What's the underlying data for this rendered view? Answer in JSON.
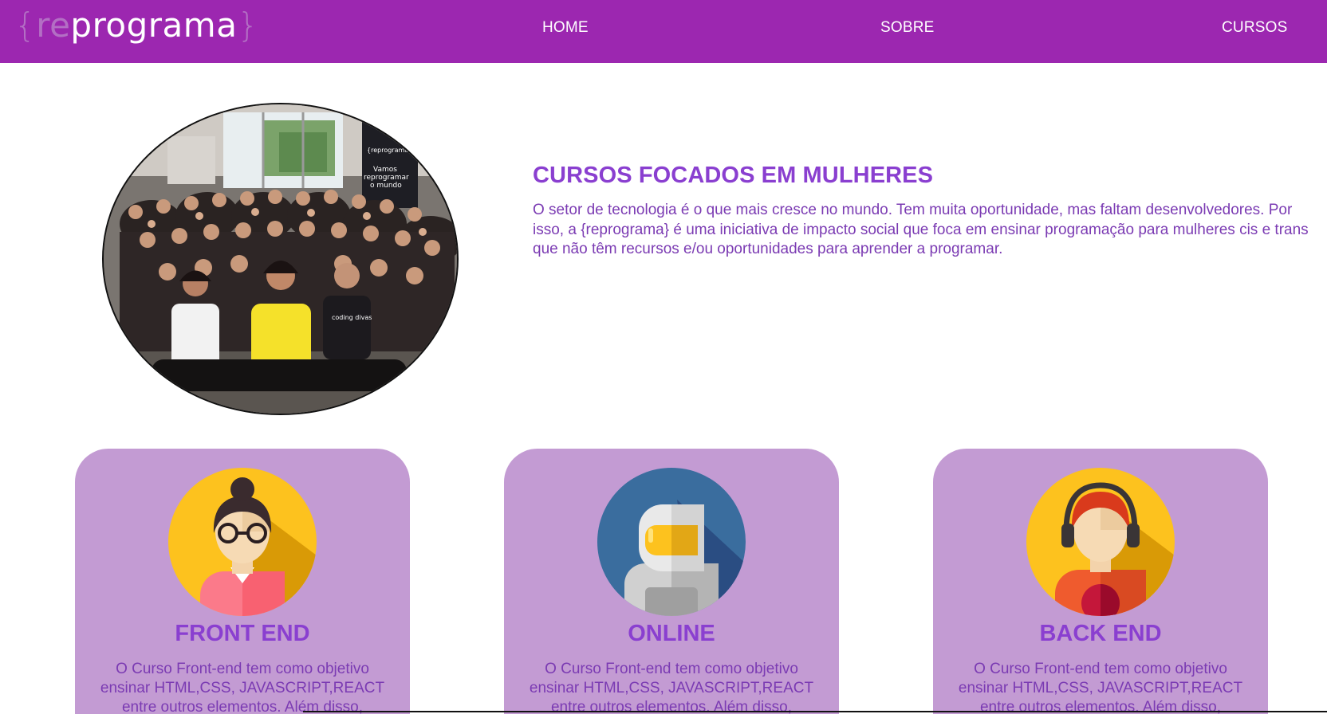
{
  "nav": {
    "logo": {
      "brace_open": "{",
      "re": "re",
      "word": "programa",
      "brace_close": "}"
    },
    "links": [
      "HOME",
      "SOBRE",
      "CURSOS"
    ]
  },
  "hero": {
    "title": "CURSOS FOCADOS EM MULHERES",
    "text": "O setor de tecnologia é o que mais cresce no mundo. Tem muita oportunidade, mas faltam desenvolvedores. Por isso, a {reprograma} é uma iniciativa de impacto social que foca em ensinar programação para mulheres cis e trans que não têm recursos e/ou oportunidades para aprender a programar.",
    "photo_banner": {
      "brand": "{reprograma}",
      "line1": "Vamos",
      "line2": "reprogramar",
      "line3": "o mundo"
    },
    "photo_shirt": "coding divas"
  },
  "cards": [
    {
      "title": "FRONT END",
      "text": "O Curso Front-end tem como objetivo ensinar HTML,CSS, JAVASCRIPT,REACT entre outros elementos. Além disso,",
      "icon": "woman-avatar-icon"
    },
    {
      "title": "ONLINE",
      "text": "O Curso Front-end tem como objetivo ensinar HTML,CSS, JAVASCRIPT,REACT entre outros elementos. Além disso,",
      "icon": "astronaut-avatar-icon"
    },
    {
      "title": "BACK END",
      "text": "O Curso Front-end tem como objetivo ensinar HTML,CSS, JAVASCRIPT,REACT entre outros elementos. Além disso,",
      "icon": "headset-avatar-icon"
    }
  ],
  "colors": {
    "navbar": "#9c27b0",
    "heading": "#8a3fd0",
    "body_text": "#7b3bb3",
    "card_bg": "#c39bd3"
  }
}
